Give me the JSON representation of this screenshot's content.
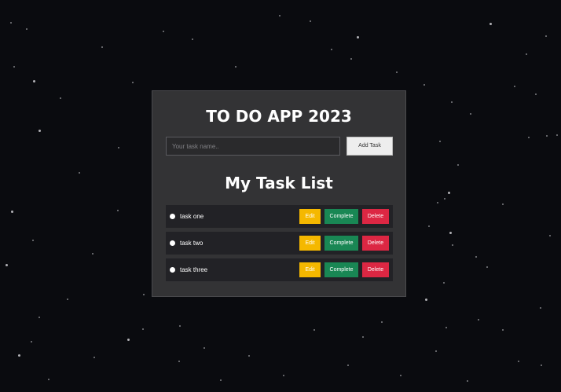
{
  "app": {
    "title": "TO DO APP 2023"
  },
  "form": {
    "placeholder": "Your task name..",
    "add_label": "Add Task"
  },
  "list": {
    "title": "My Task List",
    "tasks": [
      {
        "name": "task one"
      },
      {
        "name": "task two"
      },
      {
        "name": "task three"
      }
    ],
    "edit_label": "Edit",
    "complete_label": "Complete",
    "delete_label": "Delete"
  },
  "colors": {
    "background": "#0a0b0f",
    "card": "#333335",
    "edit": "#f5b800",
    "complete": "#198754",
    "delete": "#dc2743"
  }
}
